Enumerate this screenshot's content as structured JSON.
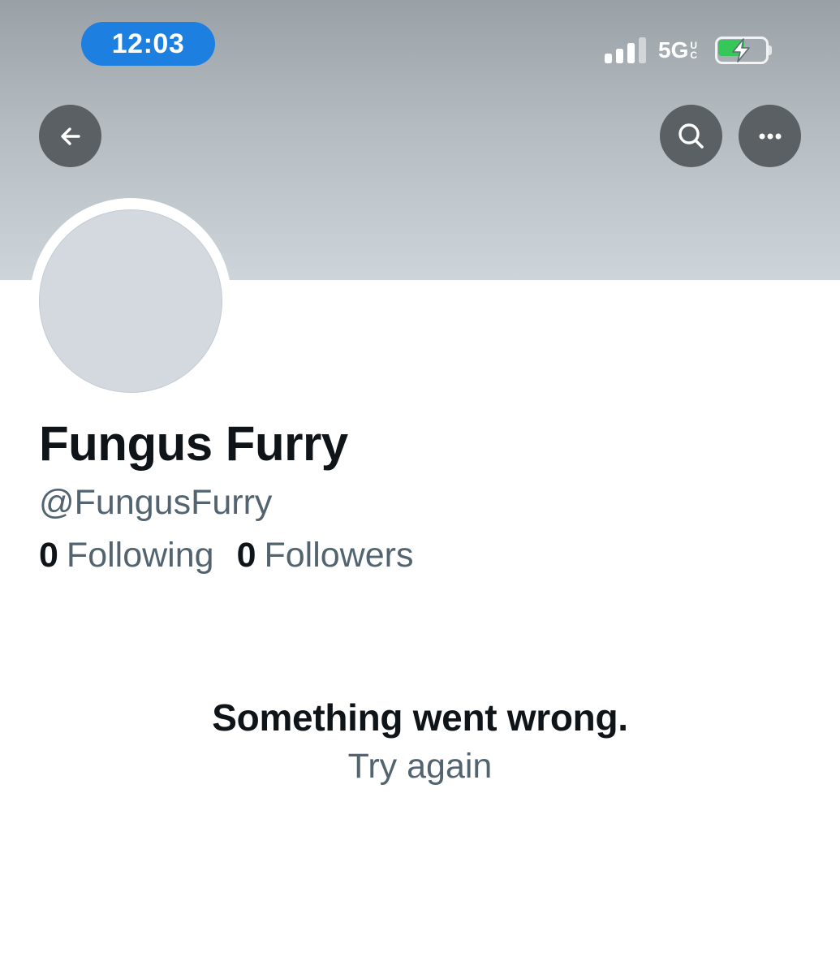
{
  "status_bar": {
    "time": "12:03",
    "network": "5G",
    "network_sub_top": "U",
    "network_sub_bottom": "C",
    "battery_fill_fraction": 0.55,
    "battery_color": "#36c759",
    "time_pill_color": "#1d7fe0"
  },
  "header": {
    "back_icon": "arrow-left-icon",
    "search_icon": "search-icon",
    "more_icon": "more-horizontal-icon"
  },
  "profile": {
    "display_name": "Fungus Furry",
    "handle": "@FungusFurry",
    "following_count": "0",
    "following_label": "Following",
    "followers_count": "0",
    "followers_label": "Followers"
  },
  "error": {
    "title": "Something went wrong.",
    "retry_label": "Try again"
  }
}
